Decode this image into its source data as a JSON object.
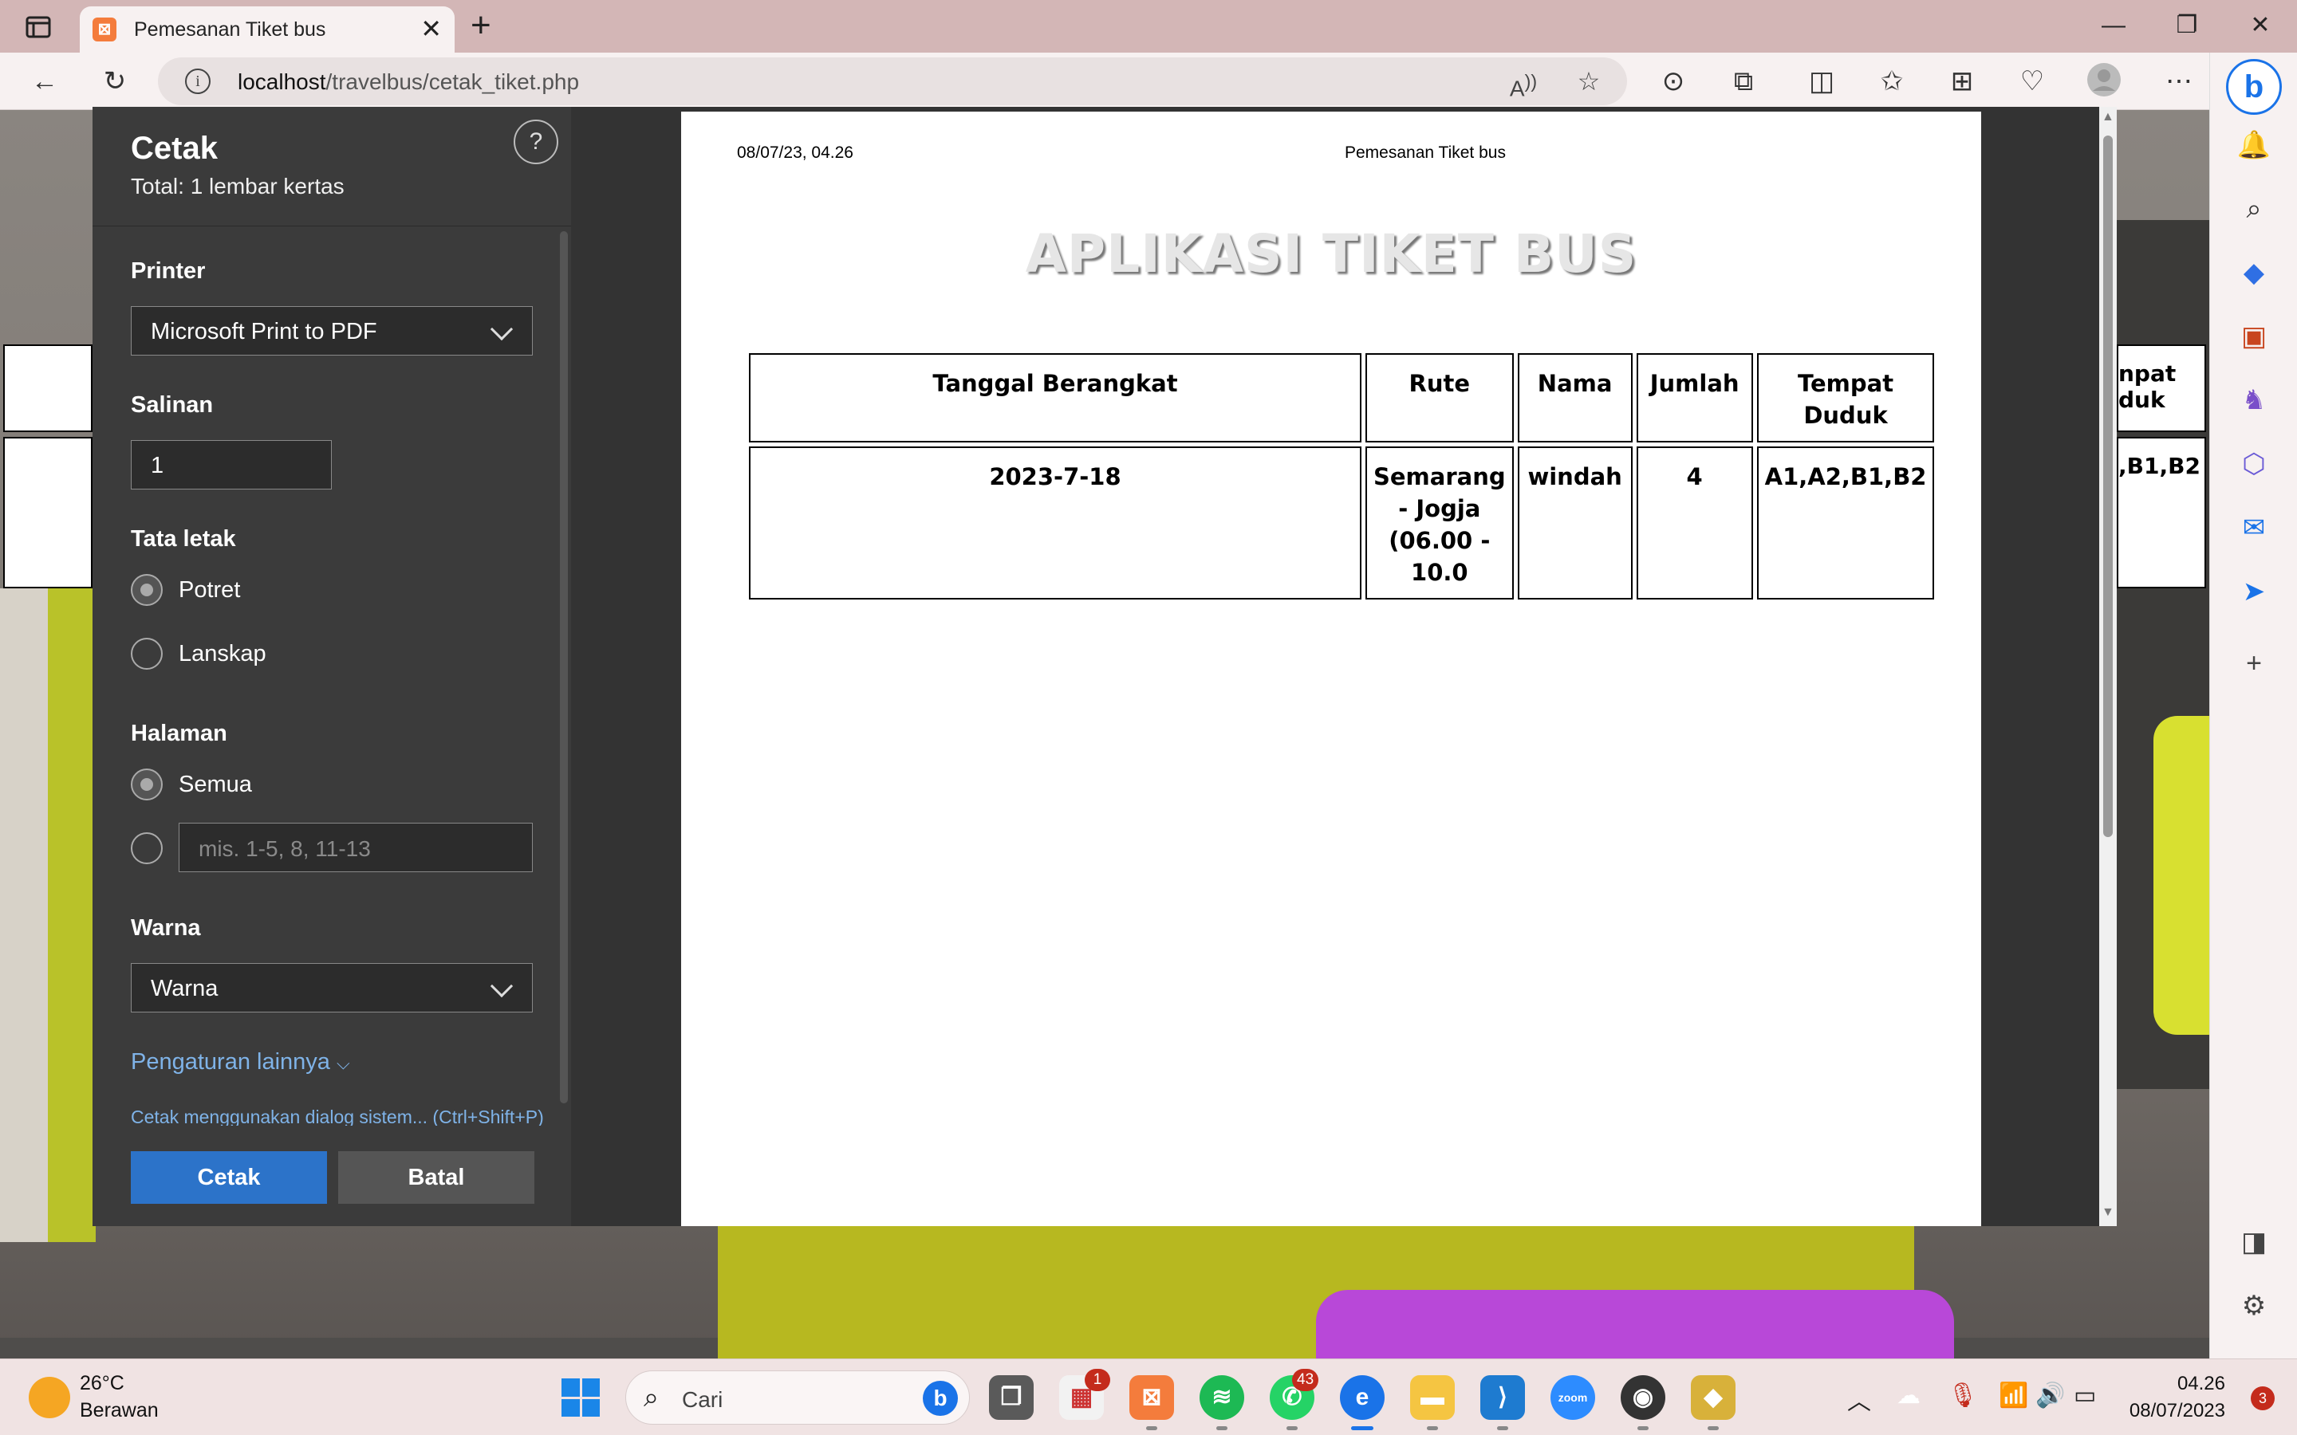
{
  "browser": {
    "tab_title": "Pemesanan Tiket bus",
    "tab_close": "✕",
    "new_tab": "+",
    "url_host": "localhost",
    "url_path": "/travelbus/cetak_tiket.php",
    "win_minimize": "—",
    "win_restore": "❐",
    "win_close": "✕"
  },
  "print_panel": {
    "title": "Cetak",
    "total": "Total: 1 lembar kertas",
    "help": "?",
    "printer_label": "Printer",
    "printer_value": "Microsoft Print to PDF",
    "copies_label": "Salinan",
    "copies_value": "1",
    "layout_label": "Tata letak",
    "layout_options": [
      "Potret",
      "Lanskap"
    ],
    "layout_selected": "Potret",
    "pages_label": "Halaman",
    "pages_all": "Semua",
    "pages_placeholder": "mis. 1-5, 8, 11-13",
    "color_label": "Warna",
    "color_value": "Warna",
    "more_settings": "Pengaturan lainnya",
    "system_dialog": "Cetak menggunakan dialog sistem... (Ctrl+Shift+P)",
    "print_button": "Cetak",
    "cancel_button": "Batal"
  },
  "preview": {
    "header_date": "08/07/23, 04.26",
    "header_title": "Pemesanan Tiket bus",
    "app_title": "APLIKASI TIKET BUS",
    "table": {
      "headers": [
        "Tanggal Berangkat",
        "Rute",
        "Nama",
        "Jumlah",
        "Tempat Duduk"
      ],
      "rows": [
        [
          "2023-7-18",
          "Semarang - Jogja (06.00 - 10.0",
          "windah",
          "4",
          "A1,A2,B1,B2"
        ]
      ]
    }
  },
  "background_page": {
    "header_fragment": "npat duk",
    "cell_fragment": ",B1,B2"
  },
  "taskbar": {
    "weather_temp": "26°C",
    "weather_desc": "Berawan",
    "search_text": "Cari",
    "badges": {
      "xampp": "1",
      "whatsapp": "43"
    },
    "time": "04.26",
    "date": "08/07/2023",
    "notifications": "3"
  },
  "icons": {
    "back": "back-arrow-icon",
    "refresh": "refresh-icon",
    "info": "info-icon",
    "read_aloud": "read-aloud-icon",
    "favorite": "star-icon",
    "extensions": "puzzle-icon",
    "split": "split-screen-icon",
    "favorites": "favorites-icon",
    "collections": "collections-icon",
    "health": "browser-essentials-icon",
    "profile": "profile-icon",
    "more": "more-icon",
    "bing": "bing-icon"
  },
  "colors": {
    "tabbar": "#d3b6b6",
    "panel": "#3b3b3b",
    "primary_button": "#2c73c9",
    "link": "#7fb3e8"
  }
}
